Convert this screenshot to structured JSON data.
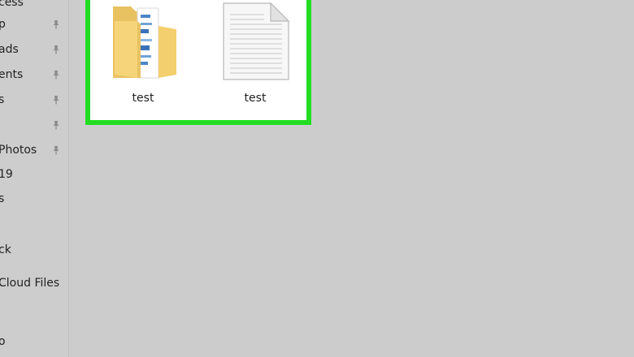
{
  "nav": {
    "items": [
      {
        "label": "cess",
        "pinned": false
      },
      {
        "label": "p",
        "pinned": true
      },
      {
        "label": "ads",
        "pinned": true
      },
      {
        "label": "ents",
        "pinned": true
      },
      {
        "label": "s",
        "pinned": true
      },
      {
        "label": "",
        "pinned": true
      },
      {
        "label": "Photos",
        "pinned": true
      },
      {
        "label": "19",
        "pinned": false
      },
      {
        "label": "s",
        "pinned": false
      },
      {
        "label": "ck",
        "pinned": false
      },
      {
        "label": "Cloud Files",
        "pinned": false
      },
      {
        "label": "o",
        "pinned": false
      }
    ]
  },
  "files": [
    {
      "name": "test",
      "kind": "folder-icon"
    },
    {
      "name": "test",
      "kind": "text-document-icon"
    }
  ],
  "colors": {
    "highlight": "#22dd22",
    "background": "#cccccc",
    "folder": "#f5d47a"
  }
}
